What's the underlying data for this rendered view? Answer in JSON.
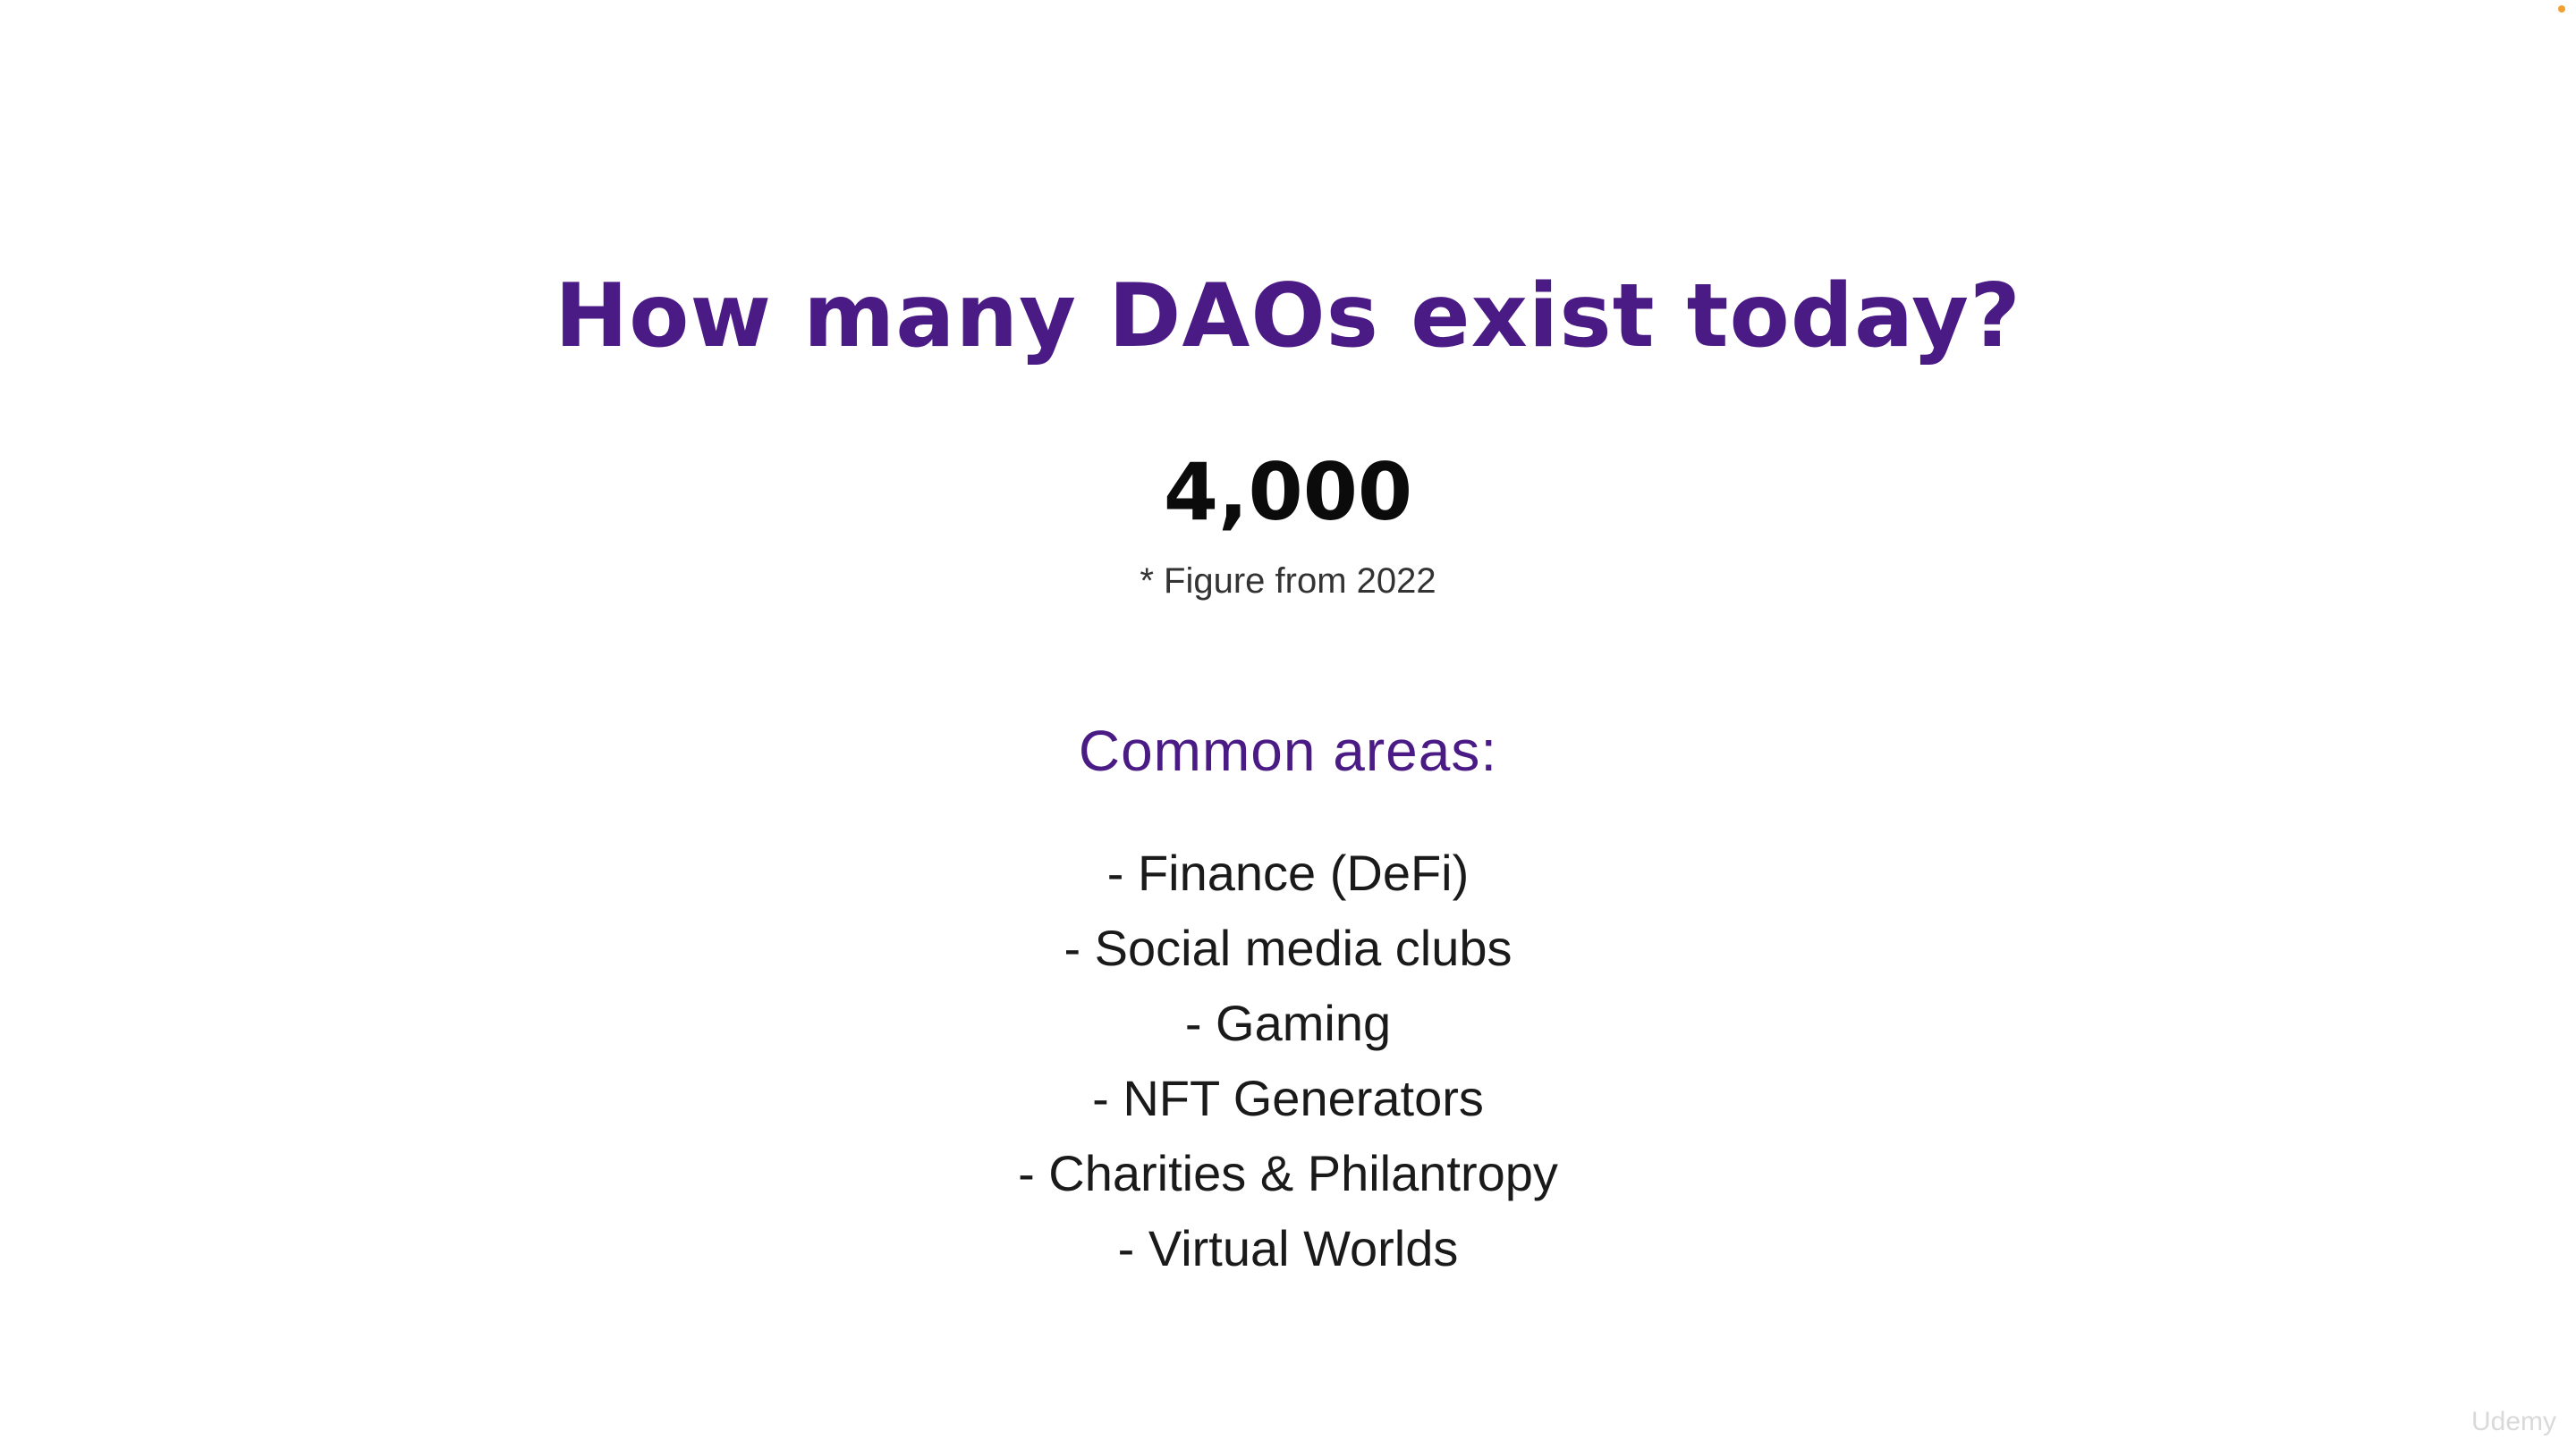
{
  "slide": {
    "title": "How many DAOs exist today?",
    "figure": "4,000",
    "footnote": "* Figure from 2022",
    "subheading": "Common areas:",
    "areas": [
      "- Finance (DeFi)",
      "- Social media clubs",
      "- Gaming",
      "- NFT Generators",
      "- Charities & Philantropy",
      "- Virtual Worlds"
    ]
  },
  "watermark": "Udemy",
  "colors": {
    "title": "#4a1a85",
    "figure": "#0b0b0b",
    "body_text": "#1a1a1a",
    "background": "#ffffff",
    "corner_indicator": "#f0a030"
  }
}
